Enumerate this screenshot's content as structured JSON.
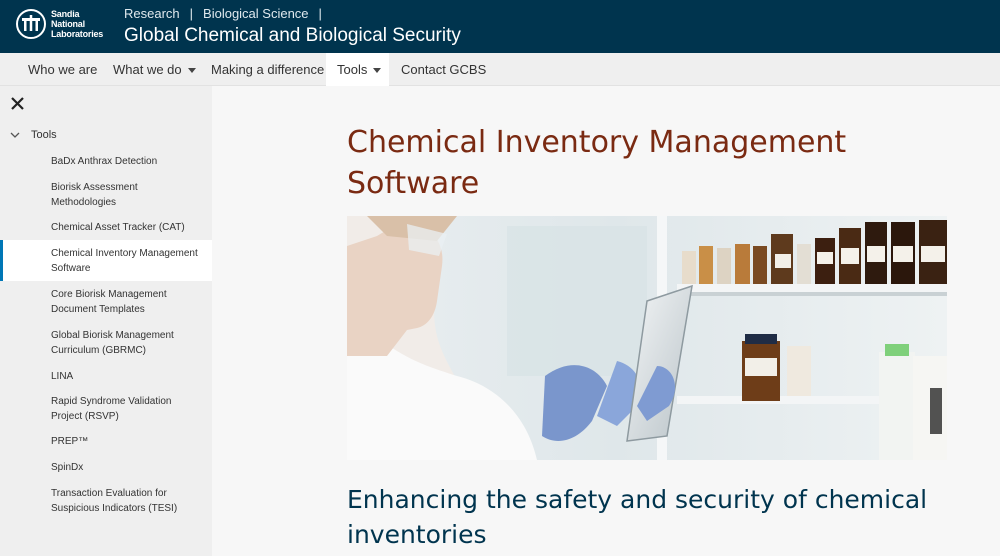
{
  "header": {
    "logo_line1": "Sandia",
    "logo_line2": "National",
    "logo_line3": "Laboratories",
    "breadcrumb": [
      "Research",
      "|",
      "Biological Science",
      "|"
    ],
    "site_title": "Global Chemical and Biological Security"
  },
  "nav": {
    "items": [
      {
        "label": "Who we are"
      },
      {
        "label": "What we do"
      },
      {
        "label": "Making a difference"
      },
      {
        "label": "Tools"
      },
      {
        "label": "Contact GCBS"
      }
    ]
  },
  "sidebar": {
    "section": "Tools",
    "items": [
      {
        "label": "BaDx Anthrax Detection"
      },
      {
        "label": "Biorisk Assessment Methodologies"
      },
      {
        "label": "Chemical Asset Tracker (CAT)"
      },
      {
        "label": "Chemical Inventory Management Software"
      },
      {
        "label": "Core Biorisk Management Document Templates"
      },
      {
        "label": "Global Biorisk Management Curriculum (GBRMC)"
      },
      {
        "label": "LINA"
      },
      {
        "label": "Rapid Syndrome Validation Project (RSVP)"
      },
      {
        "label": "PREP™"
      },
      {
        "label": "SpinDx"
      },
      {
        "label": "Transaction Evaluation for Suspicious Indicators (TESI)"
      }
    ]
  },
  "main": {
    "title": "Chemical Inventory Management Software",
    "subtitle": "Enhancing the safety and security of chemical inventories"
  },
  "colors": {
    "header_bg": "#00344e",
    "title_color": "#7a2a12",
    "subtitle_color": "#00344e",
    "active_indicator": "#0077b6"
  }
}
